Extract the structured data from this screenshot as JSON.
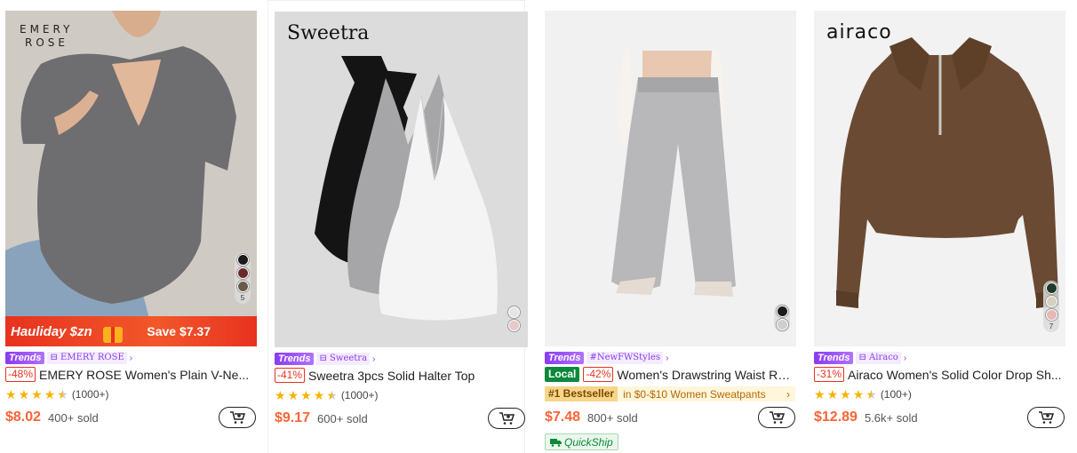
{
  "products": [
    {
      "brand_logo_line1": "EMERY",
      "brand_logo_line2": "ROSE",
      "swatch_count": "5",
      "swatch_colors": [
        "#1a1a1a",
        "#6b2a2a",
        "#6b5a4a"
      ],
      "promo": {
        "left": "Hauliday $zn",
        "right": "Save $7.37"
      },
      "trend_label": "Trends",
      "brand_tag": "EMERY ROSE",
      "discount": "-48%",
      "title": "EMERY ROSE Women's Plain V-Ne...",
      "rating_stars": 4.5,
      "rating_count": "(1000+)",
      "price": "$8.02",
      "sold": "400+ sold"
    },
    {
      "brand_logo": "Sweetra",
      "swatch_colors": [
        "#e6e6e6",
        "#e8c9c9"
      ],
      "trend_label": "Trends",
      "brand_tag": "Sweetra",
      "discount": "-41%",
      "title": "Sweetra 3pcs Solid Halter Top",
      "rating_stars": 4.5,
      "rating_count": "(1000+)",
      "price": "$9.17",
      "sold": "600+ sold"
    },
    {
      "swatch_colors": [
        "#1a1a1a",
        "#cfcfcf"
      ],
      "trend_label": "Trends",
      "brand_tag": "#NewFWStyles",
      "local_badge": "Local",
      "discount": "-42%",
      "title": "Women's Drawstring Waist Rel...",
      "bestseller": {
        "badge": "#1 Bestseller",
        "text": "in $0-$10 Women Sweatpants"
      },
      "price": "$7.48",
      "sold": "800+ sold",
      "quickship": "QuickShip"
    },
    {
      "brand_logo": "airaco",
      "swatch_count": "7",
      "swatch_colors": [
        "#1f3a2a",
        "#d8d0c0",
        "#e6b8b8"
      ],
      "trend_label": "Trends",
      "brand_tag": "Airaco",
      "discount": "-31%",
      "title": "Airaco Women's Solid Color Drop Sh...",
      "rating_stars": 4.5,
      "rating_count": "(100+)",
      "price": "$12.89",
      "sold": "5.6k+ sold"
    }
  ],
  "icons": {
    "cart": "add-to-cart-icon",
    "store": "store-icon",
    "truck": "truck-icon",
    "star": "star-icon"
  },
  "colors": {
    "price": "#fa6338",
    "trends": "#8a3cf0",
    "discount": "#e8321f",
    "local": "#0a8a3a",
    "star": "#f5b400"
  }
}
